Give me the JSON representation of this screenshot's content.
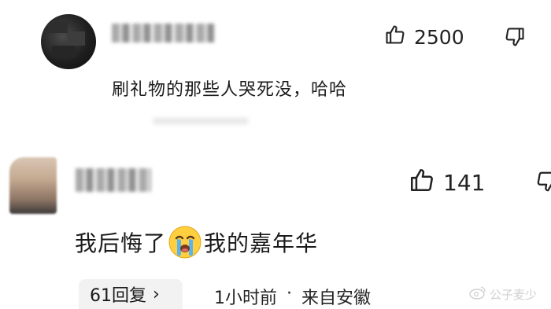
{
  "comments": [
    {
      "likes": "2500",
      "text": "刷礼物的那些人哭死没，哈哈"
    },
    {
      "likes": "141",
      "text_before_emoji": "我后悔了",
      "emoji": "crying-face",
      "text_after_emoji": "我的嘉年华",
      "reply_count_label": "61回复",
      "reply_chevron": "›",
      "time": "1小时前",
      "separator": "·",
      "location": "来自安徽"
    }
  ],
  "watermark": {
    "icon": "weibo-icon",
    "text": "公子麦少"
  }
}
